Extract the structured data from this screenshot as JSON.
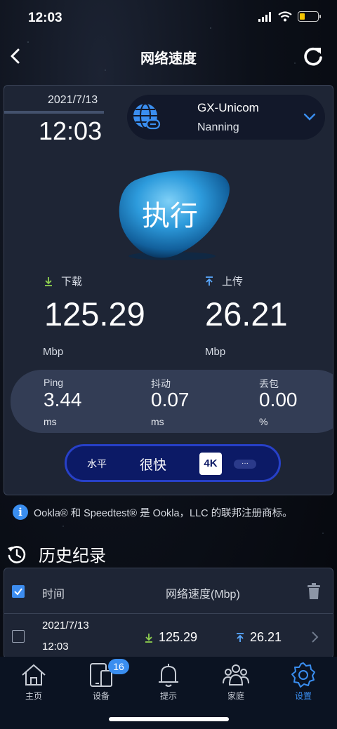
{
  "status_bar": {
    "time": "12:03"
  },
  "nav": {
    "title": "网络速度"
  },
  "test": {
    "date": "2021/7/13",
    "time": "12:03",
    "server_name": "GX-Unicom",
    "server_city": "Nanning",
    "go_label": "执行"
  },
  "download": {
    "label": "下载",
    "value": "125.29",
    "unit": "Mbp"
  },
  "upload": {
    "label": "上传",
    "value": "26.21",
    "unit": "Mbp"
  },
  "ping": {
    "label": "Ping",
    "value": "3.44",
    "unit": "ms"
  },
  "jitter": {
    "label": "抖动",
    "value": "0.07",
    "unit": "ms"
  },
  "loss": {
    "label": "丢包",
    "value": "0.00",
    "unit": "%"
  },
  "rating": {
    "level_label": "水平",
    "speed_label": "很快",
    "badge": "4K",
    "more": "···"
  },
  "notice": "Ookla® 和 Speedtest® 是 Ookla，LLC 的联邦注册商标。",
  "history": {
    "title": "历史纪录",
    "col_time": "时间",
    "col_speed": "网络速度(Mbp)",
    "rows": [
      {
        "date": "2021/7/13",
        "time": "12:03",
        "download": "125.29",
        "upload": "26.21"
      }
    ]
  },
  "tabs": [
    {
      "label": "主页",
      "icon": "home-icon"
    },
    {
      "label": "设备",
      "icon": "devices-icon",
      "badge": "16"
    },
    {
      "label": "提示",
      "icon": "bell-icon"
    },
    {
      "label": "家庭",
      "icon": "family-icon"
    },
    {
      "label": "设置",
      "icon": "gear-icon",
      "active": true
    }
  ],
  "colors": {
    "accent": "#3a8ef0",
    "card": "#1e2535",
    "rating_bg": "#0c1a66",
    "download_arrow": "#8fd14f",
    "upload_arrow": "#5aa9ff"
  }
}
